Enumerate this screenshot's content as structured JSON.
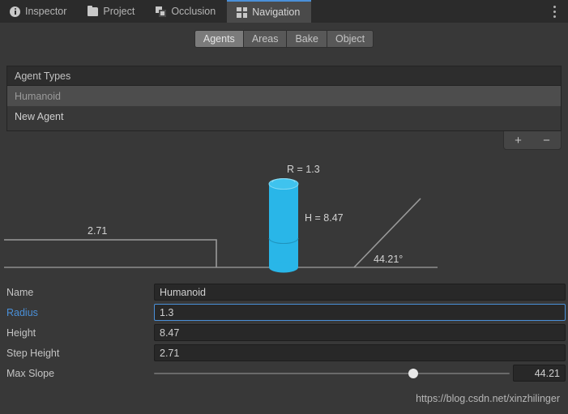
{
  "window": {
    "tabs": [
      {
        "label": "Inspector",
        "icon": "info-icon",
        "active": false
      },
      {
        "label": "Project",
        "icon": "folder-icon",
        "active": false
      },
      {
        "label": "Occlusion",
        "icon": "occlusion-icon",
        "active": false
      },
      {
        "label": "Navigation",
        "icon": "navigation-icon",
        "active": true
      }
    ],
    "menu_icon": "kebab-menu-icon"
  },
  "modebar": {
    "buttons": [
      {
        "label": "Agents",
        "active": true
      },
      {
        "label": "Areas",
        "active": false
      },
      {
        "label": "Bake",
        "active": false
      },
      {
        "label": "Object",
        "active": false
      }
    ]
  },
  "agent_types": {
    "header": "Agent Types",
    "rows": [
      {
        "label": "Humanoid",
        "selected": true
      },
      {
        "label": "New Agent",
        "selected": false
      }
    ],
    "add_label": "+",
    "remove_label": "−"
  },
  "diagram": {
    "radius_label": "R = 1.3",
    "height_label": "H = 8.47",
    "step_label": "2.71",
    "slope_label": "44.21°",
    "cylinder_color": "#29b6e8",
    "line_color": "#9a9a9a"
  },
  "properties": {
    "name": {
      "label": "Name",
      "value": "Humanoid",
      "focused": false
    },
    "radius": {
      "label": "Radius",
      "value": "1.3",
      "focused": true
    },
    "height": {
      "label": "Height",
      "value": "8.47",
      "focused": false
    },
    "step_height": {
      "label": "Step Height",
      "value": "2.71",
      "focused": false
    },
    "max_slope": {
      "label": "Max Slope",
      "value": "44.21",
      "percent": 73
    }
  },
  "watermark": {
    "text": "https://blog.csdn.net/xinzhilinger"
  },
  "colors": {
    "accent": "#4a90d9",
    "cylinder": "#29b6e8",
    "panel_bg": "#383838",
    "tabbar_bg": "#2b2b2b",
    "field_bg": "#282828"
  }
}
